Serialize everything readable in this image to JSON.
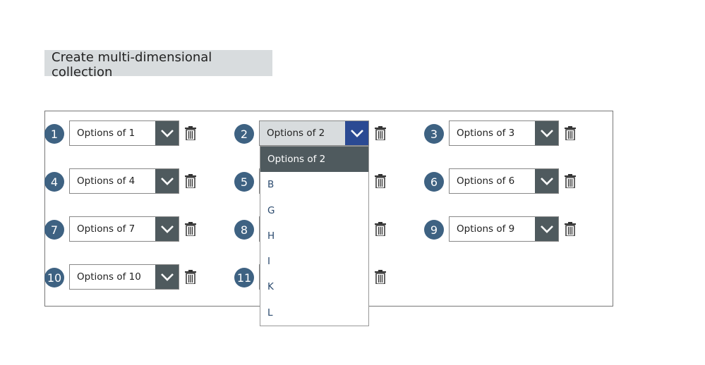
{
  "create_button": "Create multi-dimensional collection",
  "rows": [
    {
      "num": "1",
      "value": "Options of 1"
    },
    {
      "num": "2",
      "value": "Options of 2",
      "open": true
    },
    {
      "num": "3",
      "value": "Options of 3"
    },
    {
      "num": "4",
      "value": "Options of 4"
    },
    {
      "num": "5",
      "value": ""
    },
    {
      "num": "6",
      "value": "Options of 6"
    },
    {
      "num": "7",
      "value": "Options of 7"
    },
    {
      "num": "8",
      "value": ""
    },
    {
      "num": "9",
      "value": "Options of 9"
    },
    {
      "num": "10",
      "value": "Options of 10"
    },
    {
      "num": "11",
      "value": ""
    }
  ],
  "dropdown_options": [
    "Options of 2",
    "B",
    "G",
    "H",
    "I",
    "K",
    "L"
  ],
  "colors": {
    "badge": "#3e6282",
    "arrow": "#4f5a5e",
    "arrow_active": "#2b4a93"
  }
}
